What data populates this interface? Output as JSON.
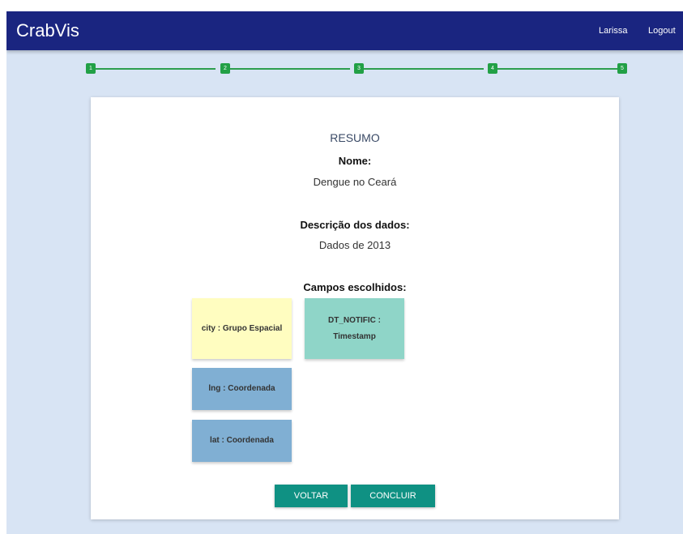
{
  "app": {
    "brand": "CrabVis"
  },
  "nav": {
    "user": "Larissa",
    "logout": "Logout"
  },
  "steps": [
    "1",
    "2",
    "3",
    "4",
    "5"
  ],
  "summary": {
    "title": "RESUMO",
    "name_label": "Nome:",
    "name_value": "Dengue no Ceará",
    "desc_label": "Descrição dos dados:",
    "desc_value": "Dados de 2013",
    "fields_label": "Campos escolhidos:"
  },
  "fields": [
    {
      "text": "city : Grupo Espacial",
      "color": "#fffdc0"
    },
    {
      "text": "DT_NOTIFIC : Timestamp",
      "color": "#8fd5c8"
    },
    {
      "text": "lng : Coordenada",
      "color": "#80afd3"
    },
    {
      "text": "lat : Coordenada",
      "color": "#80afd3"
    }
  ],
  "buttons": {
    "back": "VOLTAR",
    "finish": "CONCLUIR"
  },
  "colors": {
    "navbar": "#1a2580",
    "background": "#d8e4f4",
    "step": "#22a046",
    "button": "#0f9183"
  }
}
